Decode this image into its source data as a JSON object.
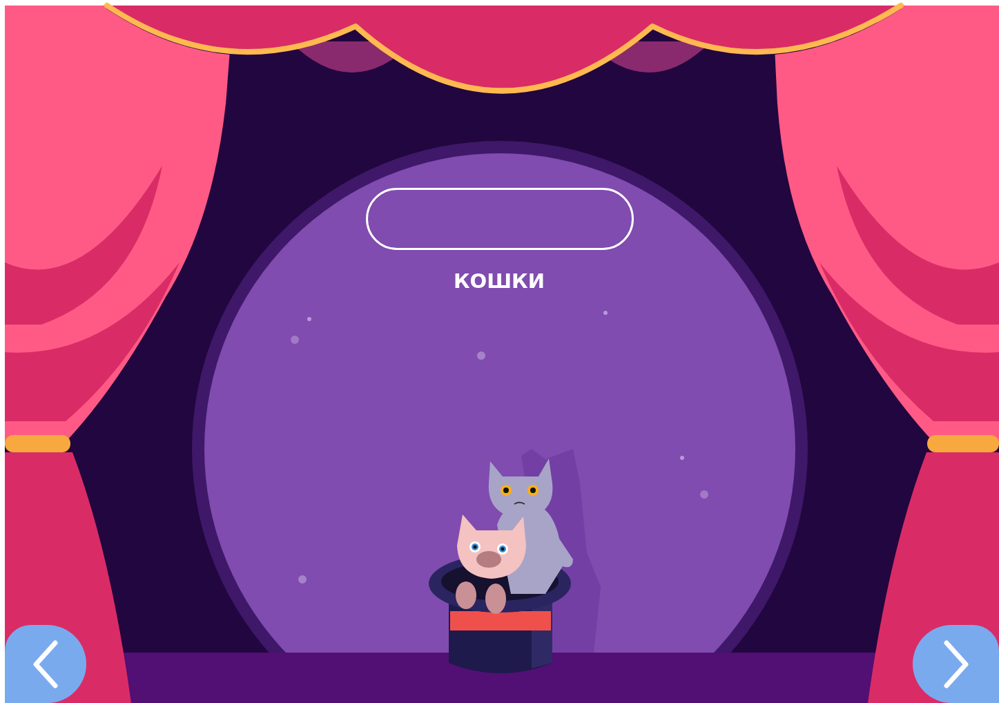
{
  "caption": "КОШКИ"
}
